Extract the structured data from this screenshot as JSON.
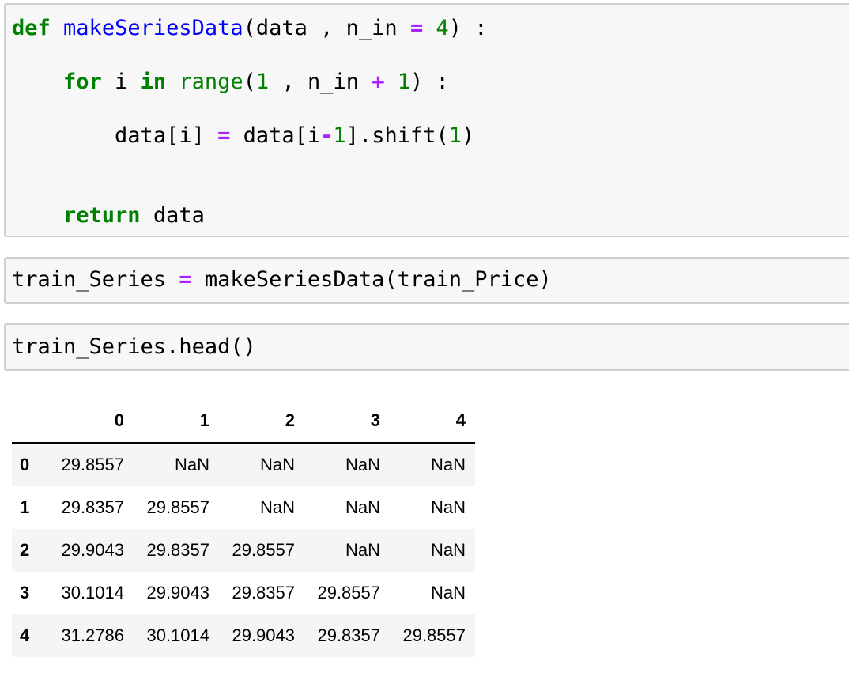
{
  "cells": {
    "def_cell": {
      "line1": {
        "kw_def": "def",
        "fn_name": "makeSeriesData",
        "args_a": "(data , n_in ",
        "eq": "=",
        "num4": "4",
        "args_b": ") :"
      },
      "line2": {
        "kw_for": "for",
        "var_i": " i ",
        "kw_in": "in",
        "bi_range": "range",
        "paren_open": "(",
        "num1a": "1",
        "mid": " , n_in ",
        "plus": "+",
        "num1b": "1",
        "tail": ") :"
      },
      "line3": {
        "lhs": "data[i] ",
        "eq": "=",
        "rhs_a": " data[i",
        "minus": "-",
        "num1": "1",
        "rhs_b": "].shift(",
        "num1b": "1",
        "rhs_c": ")"
      },
      "line4": {
        "kw_return": "return",
        "rest": " data"
      }
    },
    "assign_cell": {
      "lhs": "train_Series ",
      "eq": "=",
      "rhs": " makeSeriesData(train_Price)"
    },
    "head_cell": {
      "code": "train_Series.head()"
    }
  },
  "dataframe": {
    "columns": [
      "0",
      "1",
      "2",
      "3",
      "4"
    ],
    "rows": [
      {
        "index": "0",
        "values": [
          "29.8557",
          "NaN",
          "NaN",
          "NaN",
          "NaN"
        ]
      },
      {
        "index": "1",
        "values": [
          "29.8357",
          "29.8557",
          "NaN",
          "NaN",
          "NaN"
        ]
      },
      {
        "index": "2",
        "values": [
          "29.9043",
          "29.8357",
          "29.8557",
          "NaN",
          "NaN"
        ]
      },
      {
        "index": "3",
        "values": [
          "30.1014",
          "29.9043",
          "29.8357",
          "29.8557",
          "NaN"
        ]
      },
      {
        "index": "4",
        "values": [
          "31.2786",
          "30.1014",
          "29.9043",
          "29.8357",
          "29.8557"
        ]
      }
    ]
  },
  "colors": {
    "keyword": "#008000",
    "function": "#0000ff",
    "operator": "#aa22ff",
    "cell_background": "#f7f7f7",
    "cell_border": "#cfcfcf",
    "table_stripe": "#f5f5f5"
  }
}
